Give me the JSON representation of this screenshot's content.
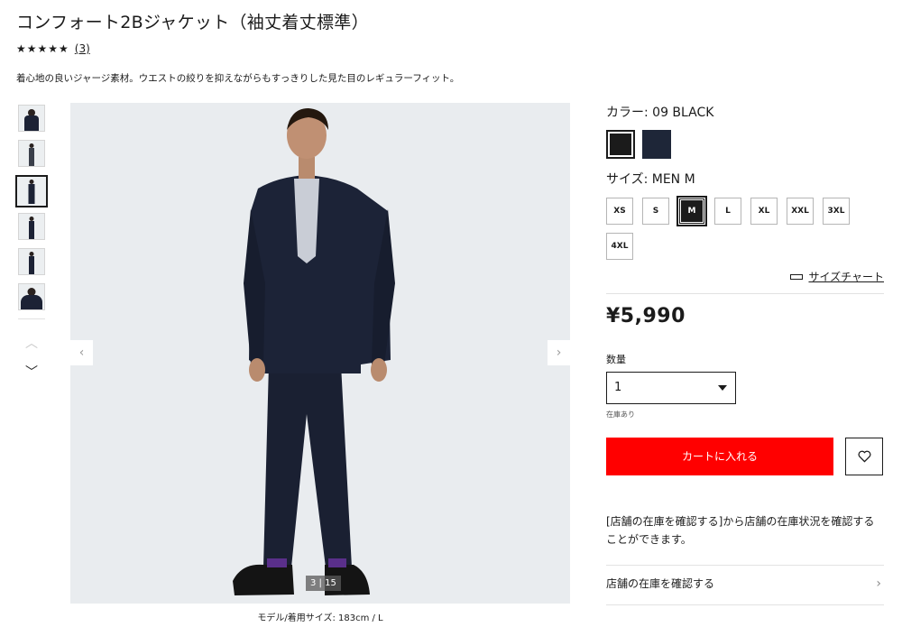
{
  "product": {
    "title": "コンフォート2Bジャケット（袖丈着丈標準）",
    "stars": "★★★★★",
    "review_count": "(3)",
    "description": "着心地の良いジャージ素材。ウエストの絞りを抑えながらもすっきりした見た目のレギュラーフィット。"
  },
  "gallery": {
    "prev_icon": "‹",
    "next_icon": "›",
    "up_icon": "︿",
    "down_icon": "﹀",
    "counter": "3 | 15",
    "caption": "モデル/着用サイズ: 183cm / L"
  },
  "color": {
    "label": "カラー:  09 BLACK",
    "swatches": [
      "#1b1b1b",
      "#1e2638"
    ]
  },
  "size": {
    "label": "サイズ:  MEN M",
    "options": [
      "XS",
      "S",
      "M",
      "L",
      "XL",
      "XXL",
      "3XL",
      "4XL"
    ],
    "selected": "M",
    "chart_label": "サイズチャート"
  },
  "price": "¥5,990",
  "quantity": {
    "label": "数量",
    "value": "1",
    "stock": "在庫あり"
  },
  "cart": {
    "add_label": "カートに入れる",
    "accent": "#ff0000"
  },
  "store": {
    "note": "[店舗の在庫を確認する]から店舗の在庫状況を確認することができます。",
    "link_label": "店舗の在庫を確認する",
    "link_icon": "›"
  }
}
